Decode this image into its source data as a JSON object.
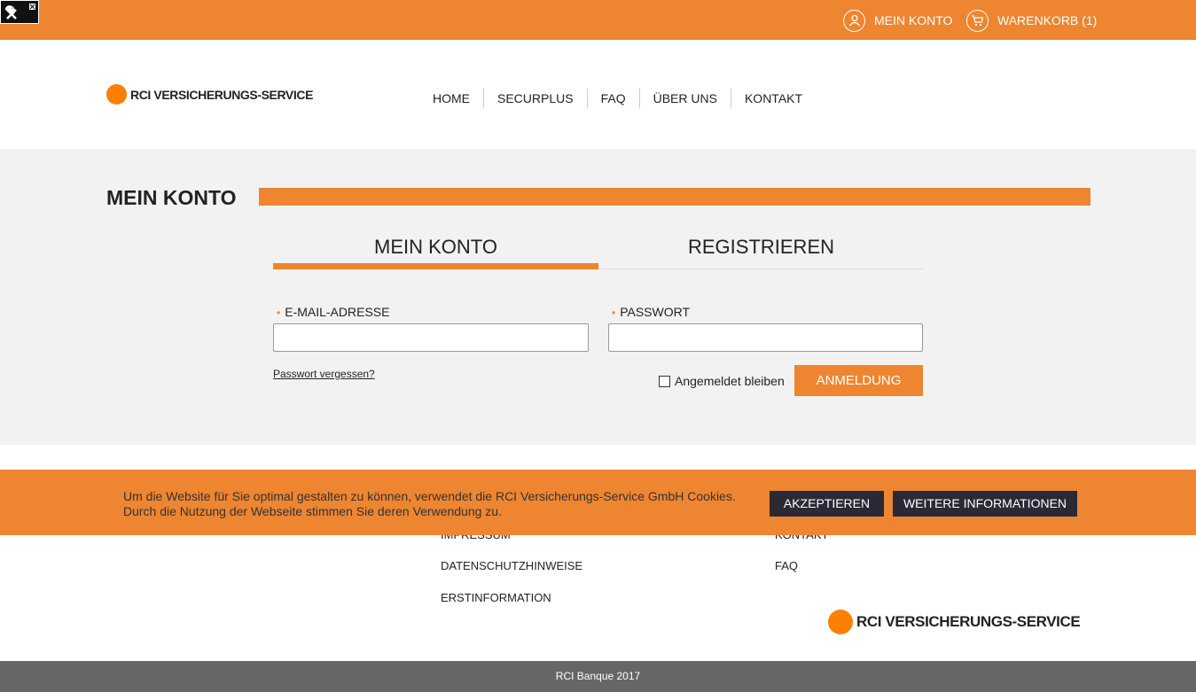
{
  "topbar": {
    "account_label": "MEIN KONTO",
    "cart_label": "WARENKORB (1)"
  },
  "brand": {
    "name": "RCI VERSICHERUNGS-SERVICE",
    "dot_color": "#ff7f00",
    "accent_color": "#ee8530"
  },
  "nav": {
    "items": [
      {
        "label": "HOME"
      },
      {
        "label": "SECURPLUS"
      },
      {
        "label": "FAQ"
      },
      {
        "label": "ÜBER UNS"
      },
      {
        "label": "KONTAKT"
      }
    ]
  },
  "main": {
    "title": "MEIN KONTO",
    "tabs": [
      {
        "label": "MEIN KONTO",
        "active": true
      },
      {
        "label": "REGISTRIEREN",
        "active": false
      }
    ],
    "form": {
      "email_label": "E-MAIL-ADRESSE",
      "email_value": "",
      "password_label": "PASSWORT",
      "password_value": "",
      "required_mark": "•",
      "forgot_link": "Passwort vergessen?",
      "remember_label": "Angemeldet bleiben",
      "remember_checked": false,
      "submit_label": "ANMELDUNG"
    }
  },
  "footer": {
    "links_left": [
      "IMPRESSUM",
      "DATENSCHUTZHINWEISE",
      "ERSTINFORMATION"
    ],
    "links_right": [
      "KONTAKT",
      "FAQ"
    ],
    "copyright": "RCI Banque 2017"
  },
  "cookie": {
    "line1": "Um die Website für Sie optimal gestalten zu können, verwendet die RCI Versicherungs-Service GmbH Cookies.",
    "line2": "Durch die Nutzung der Webseite stimmen Sie deren Verwendung zu.",
    "accept_label": "AKZEPTIEREN",
    "more_label": "WEITERE INFORMATIONEN"
  }
}
